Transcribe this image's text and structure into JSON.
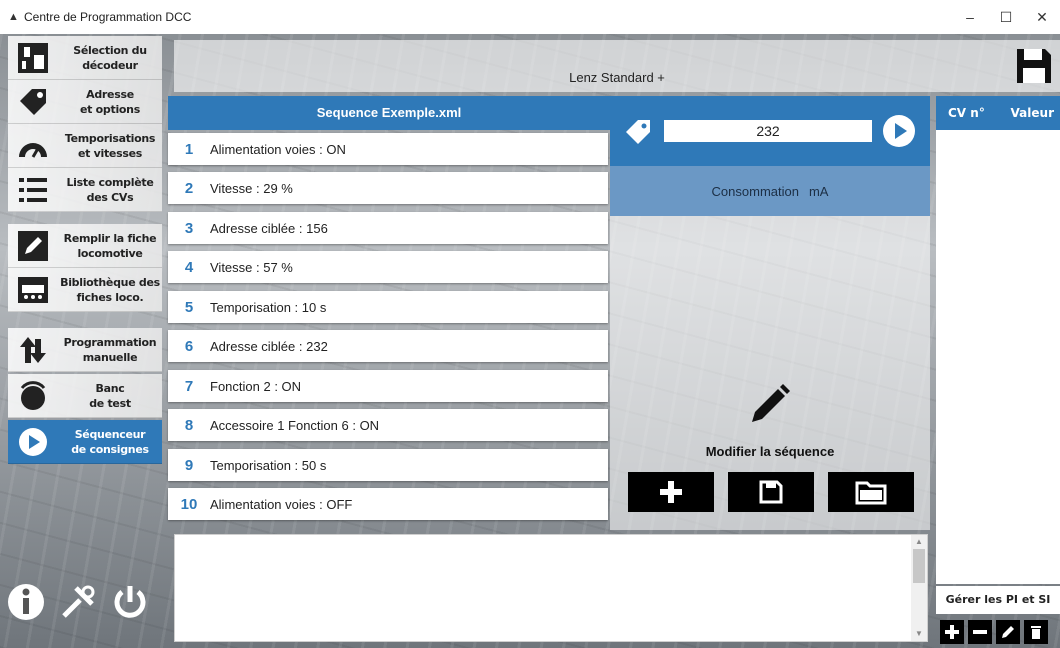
{
  "window": {
    "title": "Centre de Programmation DCC",
    "minimize": "–",
    "maximize": "☐",
    "close": "✕"
  },
  "sidebar": {
    "items": [
      {
        "label": "Sélection du\ndécodeur",
        "icon": "decoder-chip-icon"
      },
      {
        "label": "Adresse\net options",
        "icon": "tag-icon"
      },
      {
        "label": "Temporisations\net vitesses",
        "icon": "speedometer-icon"
      },
      {
        "label": "Liste complète\ndes CVs",
        "icon": "list-icon"
      },
      {
        "label": "Remplir la fiche\nlocomotive",
        "icon": "edit-pencil-icon"
      },
      {
        "label": "Bibliothèque des\nfiches loco.",
        "icon": "locomotive-icon"
      },
      {
        "label": "Programmation\nmanuelle",
        "icon": "manual-arrows-icon"
      },
      {
        "label": "Banc\nde test",
        "icon": "test-bench-icon"
      },
      {
        "label": "Séquenceur\nde consignes",
        "icon": "play-circle-icon"
      }
    ],
    "active_index": 8,
    "bottom_icons": [
      "info-icon",
      "tools-icon",
      "power-icon"
    ]
  },
  "decoder": {
    "name": "Lenz Standard +"
  },
  "sequence": {
    "file_title": "Sequence Exemple.xml",
    "steps": [
      {
        "num": "1",
        "text": "Alimentation voies : ON"
      },
      {
        "num": "2",
        "text": "Vitesse : 29 %"
      },
      {
        "num": "3",
        "text": "Adresse ciblée : 156"
      },
      {
        "num": "4",
        "text": "Vitesse : 57 %"
      },
      {
        "num": "5",
        "text": "Temporisation : 10 s"
      },
      {
        "num": "6",
        "text": "Adresse ciblée : 232"
      },
      {
        "num": "7",
        "text": "Fonction 2 : ON"
      },
      {
        "num": "8",
        "text": "Accessoire 1 Fonction 6 : ON"
      },
      {
        "num": "9",
        "text": "Temporisation : 50 s"
      },
      {
        "num": "10",
        "text": "Alimentation voies : OFF"
      }
    ]
  },
  "control": {
    "address_value": "232",
    "consumption_label": "Consommation",
    "consumption_unit": "mA",
    "edit_label": "Modifier la séquence",
    "buttons": [
      "add-icon",
      "save-icon",
      "open-folder-icon"
    ]
  },
  "cv_table": {
    "col_cv": "CV n°",
    "col_value": "Valeur",
    "manage_button": "Gérer les PI et SI",
    "tools": [
      "plus-icon",
      "minus-icon",
      "edit-icon",
      "trash-icon"
    ]
  },
  "colors": {
    "accent": "#2f79b8",
    "consumption_bar": "#6b98c5"
  }
}
